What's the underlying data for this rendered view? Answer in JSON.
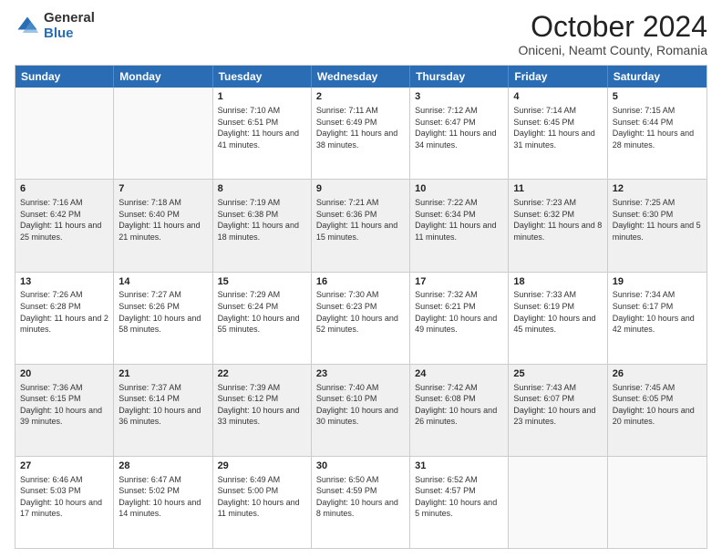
{
  "header": {
    "logo": {
      "general": "General",
      "blue": "Blue"
    },
    "title": "October 2024",
    "subtitle": "Oniceni, Neamt County, Romania"
  },
  "weekdays": [
    "Sunday",
    "Monday",
    "Tuesday",
    "Wednesday",
    "Thursday",
    "Friday",
    "Saturday"
  ],
  "rows": [
    [
      {
        "day": "",
        "empty": true
      },
      {
        "day": "",
        "empty": true
      },
      {
        "day": "1",
        "rise": "Sunrise: 7:10 AM",
        "set": "Sunset: 6:51 PM",
        "daylight": "Daylight: 11 hours and 41 minutes."
      },
      {
        "day": "2",
        "rise": "Sunrise: 7:11 AM",
        "set": "Sunset: 6:49 PM",
        "daylight": "Daylight: 11 hours and 38 minutes."
      },
      {
        "day": "3",
        "rise": "Sunrise: 7:12 AM",
        "set": "Sunset: 6:47 PM",
        "daylight": "Daylight: 11 hours and 34 minutes."
      },
      {
        "day": "4",
        "rise": "Sunrise: 7:14 AM",
        "set": "Sunset: 6:45 PM",
        "daylight": "Daylight: 11 hours and 31 minutes."
      },
      {
        "day": "5",
        "rise": "Sunrise: 7:15 AM",
        "set": "Sunset: 6:44 PM",
        "daylight": "Daylight: 11 hours and 28 minutes."
      }
    ],
    [
      {
        "day": "6",
        "rise": "Sunrise: 7:16 AM",
        "set": "Sunset: 6:42 PM",
        "daylight": "Daylight: 11 hours and 25 minutes."
      },
      {
        "day": "7",
        "rise": "Sunrise: 7:18 AM",
        "set": "Sunset: 6:40 PM",
        "daylight": "Daylight: 11 hours and 21 minutes."
      },
      {
        "day": "8",
        "rise": "Sunrise: 7:19 AM",
        "set": "Sunset: 6:38 PM",
        "daylight": "Daylight: 11 hours and 18 minutes."
      },
      {
        "day": "9",
        "rise": "Sunrise: 7:21 AM",
        "set": "Sunset: 6:36 PM",
        "daylight": "Daylight: 11 hours and 15 minutes."
      },
      {
        "day": "10",
        "rise": "Sunrise: 7:22 AM",
        "set": "Sunset: 6:34 PM",
        "daylight": "Daylight: 11 hours and 11 minutes."
      },
      {
        "day": "11",
        "rise": "Sunrise: 7:23 AM",
        "set": "Sunset: 6:32 PM",
        "daylight": "Daylight: 11 hours and 8 minutes."
      },
      {
        "day": "12",
        "rise": "Sunrise: 7:25 AM",
        "set": "Sunset: 6:30 PM",
        "daylight": "Daylight: 11 hours and 5 minutes."
      }
    ],
    [
      {
        "day": "13",
        "rise": "Sunrise: 7:26 AM",
        "set": "Sunset: 6:28 PM",
        "daylight": "Daylight: 11 hours and 2 minutes."
      },
      {
        "day": "14",
        "rise": "Sunrise: 7:27 AM",
        "set": "Sunset: 6:26 PM",
        "daylight": "Daylight: 10 hours and 58 minutes."
      },
      {
        "day": "15",
        "rise": "Sunrise: 7:29 AM",
        "set": "Sunset: 6:24 PM",
        "daylight": "Daylight: 10 hours and 55 minutes."
      },
      {
        "day": "16",
        "rise": "Sunrise: 7:30 AM",
        "set": "Sunset: 6:23 PM",
        "daylight": "Daylight: 10 hours and 52 minutes."
      },
      {
        "day": "17",
        "rise": "Sunrise: 7:32 AM",
        "set": "Sunset: 6:21 PM",
        "daylight": "Daylight: 10 hours and 49 minutes."
      },
      {
        "day": "18",
        "rise": "Sunrise: 7:33 AM",
        "set": "Sunset: 6:19 PM",
        "daylight": "Daylight: 10 hours and 45 minutes."
      },
      {
        "day": "19",
        "rise": "Sunrise: 7:34 AM",
        "set": "Sunset: 6:17 PM",
        "daylight": "Daylight: 10 hours and 42 minutes."
      }
    ],
    [
      {
        "day": "20",
        "rise": "Sunrise: 7:36 AM",
        "set": "Sunset: 6:15 PM",
        "daylight": "Daylight: 10 hours and 39 minutes."
      },
      {
        "day": "21",
        "rise": "Sunrise: 7:37 AM",
        "set": "Sunset: 6:14 PM",
        "daylight": "Daylight: 10 hours and 36 minutes."
      },
      {
        "day": "22",
        "rise": "Sunrise: 7:39 AM",
        "set": "Sunset: 6:12 PM",
        "daylight": "Daylight: 10 hours and 33 minutes."
      },
      {
        "day": "23",
        "rise": "Sunrise: 7:40 AM",
        "set": "Sunset: 6:10 PM",
        "daylight": "Daylight: 10 hours and 30 minutes."
      },
      {
        "day": "24",
        "rise": "Sunrise: 7:42 AM",
        "set": "Sunset: 6:08 PM",
        "daylight": "Daylight: 10 hours and 26 minutes."
      },
      {
        "day": "25",
        "rise": "Sunrise: 7:43 AM",
        "set": "Sunset: 6:07 PM",
        "daylight": "Daylight: 10 hours and 23 minutes."
      },
      {
        "day": "26",
        "rise": "Sunrise: 7:45 AM",
        "set": "Sunset: 6:05 PM",
        "daylight": "Daylight: 10 hours and 20 minutes."
      }
    ],
    [
      {
        "day": "27",
        "rise": "Sunrise: 6:46 AM",
        "set": "Sunset: 5:03 PM",
        "daylight": "Daylight: 10 hours and 17 minutes."
      },
      {
        "day": "28",
        "rise": "Sunrise: 6:47 AM",
        "set": "Sunset: 5:02 PM",
        "daylight": "Daylight: 10 hours and 14 minutes."
      },
      {
        "day": "29",
        "rise": "Sunrise: 6:49 AM",
        "set": "Sunset: 5:00 PM",
        "daylight": "Daylight: 10 hours and 11 minutes."
      },
      {
        "day": "30",
        "rise": "Sunrise: 6:50 AM",
        "set": "Sunset: 4:59 PM",
        "daylight": "Daylight: 10 hours and 8 minutes."
      },
      {
        "day": "31",
        "rise": "Sunrise: 6:52 AM",
        "set": "Sunset: 4:57 PM",
        "daylight": "Daylight: 10 hours and 5 minutes."
      },
      {
        "day": "",
        "empty": true
      },
      {
        "day": "",
        "empty": true
      }
    ]
  ]
}
